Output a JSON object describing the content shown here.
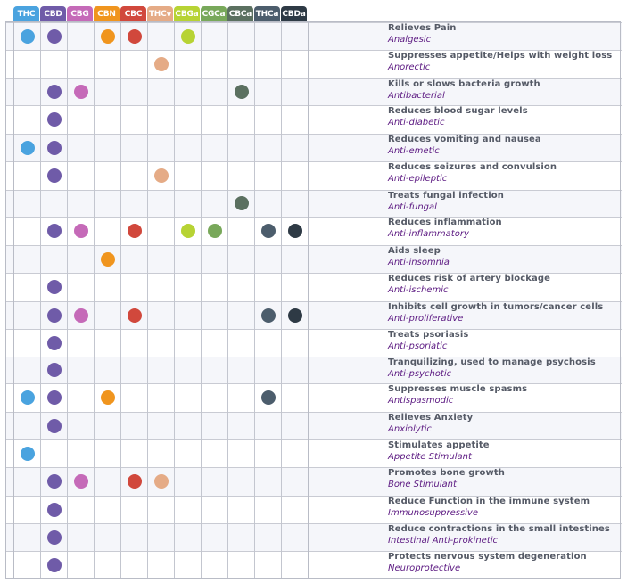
{
  "columns": [
    {
      "label": "THC",
      "color": "#4aa3df"
    },
    {
      "label": "CBD",
      "color": "#6f5ba8"
    },
    {
      "label": "CBG",
      "color": "#c56ab8"
    },
    {
      "label": "CBN",
      "color": "#f0951e"
    },
    {
      "label": "CBC",
      "color": "#d1483c"
    },
    {
      "label": "THCv",
      "color": "#e5ab86"
    },
    {
      "label": "CBGa",
      "color": "#b7d334"
    },
    {
      "label": "CGCa",
      "color": "#78a85a"
    },
    {
      "label": "CBCa",
      "color": "#5b7060"
    },
    {
      "label": "THCa",
      "color": "#4c5d6c"
    },
    {
      "label": "CBDa",
      "color": "#2e3a45"
    }
  ],
  "rows": [
    {
      "effect": "Relieves Pain",
      "term": "Analgesic",
      "marks": [
        "THC",
        "CBD",
        "CBN",
        "CBC",
        "CBGa"
      ]
    },
    {
      "effect": "Suppresses appetite/Helps with weight loss",
      "term": "Anorectic",
      "marks": [
        "THCv"
      ]
    },
    {
      "effect": "Kills or slows bacteria growth",
      "term": "Antibacterial",
      "marks": [
        "CBD",
        "CBG",
        "CBCa"
      ]
    },
    {
      "effect": "Reduces blood sugar levels",
      "term": "Anti-diabetic",
      "marks": [
        "CBD"
      ]
    },
    {
      "effect": "Reduces vomiting and nausea",
      "term": "Anti-emetic",
      "marks": [
        "THC",
        "CBD"
      ]
    },
    {
      "effect": "Reduces seizures and convulsion",
      "term": "Anti-epileptic",
      "marks": [
        "CBD",
        "THCv"
      ]
    },
    {
      "effect": "Treats fungal infection",
      "term": "Anti-fungal",
      "marks": [
        "CBCa"
      ]
    },
    {
      "effect": "Reduces inflammation",
      "term": "Anti-inflammatory",
      "marks": [
        "CBD",
        "CBG",
        "CBC",
        "CBGa",
        "CGCa",
        "THCa",
        "CBDa"
      ]
    },
    {
      "effect": "Aids sleep",
      "term": "Anti-insomnia",
      "marks": [
        "CBN"
      ]
    },
    {
      "effect": "Reduces risk of artery blockage",
      "term": "Anti-ischemic",
      "marks": [
        "CBD"
      ]
    },
    {
      "effect": "Inhibits cell growth in tumors/cancer cells",
      "term": "Anti-proliferative",
      "marks": [
        "CBD",
        "CBG",
        "CBC",
        "THCa",
        "CBDa"
      ]
    },
    {
      "effect": "Treats psoriasis",
      "term": "Anti-psoriatic",
      "marks": [
        "CBD"
      ]
    },
    {
      "effect": "Tranquilizing, used to manage psychosis",
      "term": "Anti-psychotic",
      "marks": [
        "CBD"
      ]
    },
    {
      "effect": "Suppresses muscle spasms",
      "term": "Antispasmodic",
      "marks": [
        "THC",
        "CBD",
        "CBN",
        "THCa"
      ]
    },
    {
      "effect": "Relieves Anxiety",
      "term": "Anxiolytic",
      "marks": [
        "CBD"
      ]
    },
    {
      "effect": "Stimulates appetite",
      "term": "Appetite Stimulant",
      "marks": [
        "THC"
      ]
    },
    {
      "effect": "Promotes bone growth",
      "term": "Bone Stimulant",
      "marks": [
        "CBD",
        "CBG",
        "CBC",
        "THCv"
      ]
    },
    {
      "effect": "Reduce Function in the immune system",
      "term": "Immunosuppressive",
      "marks": [
        "CBD"
      ]
    },
    {
      "effect": "Reduce contractions in the small intestines",
      "term": "Intestinal Anti-prokinetic",
      "marks": [
        "CBD"
      ]
    },
    {
      "effect": "Protects nervous system degeneration",
      "term": "Neuroprotective",
      "marks": [
        "CBD"
      ]
    }
  ],
  "colors": {
    "row_alt": "#f5f6fa",
    "row_base": "#ffffff",
    "grid": "#c9cbd3",
    "effect_text": "#555a66",
    "term_text": "#5c1a82"
  }
}
